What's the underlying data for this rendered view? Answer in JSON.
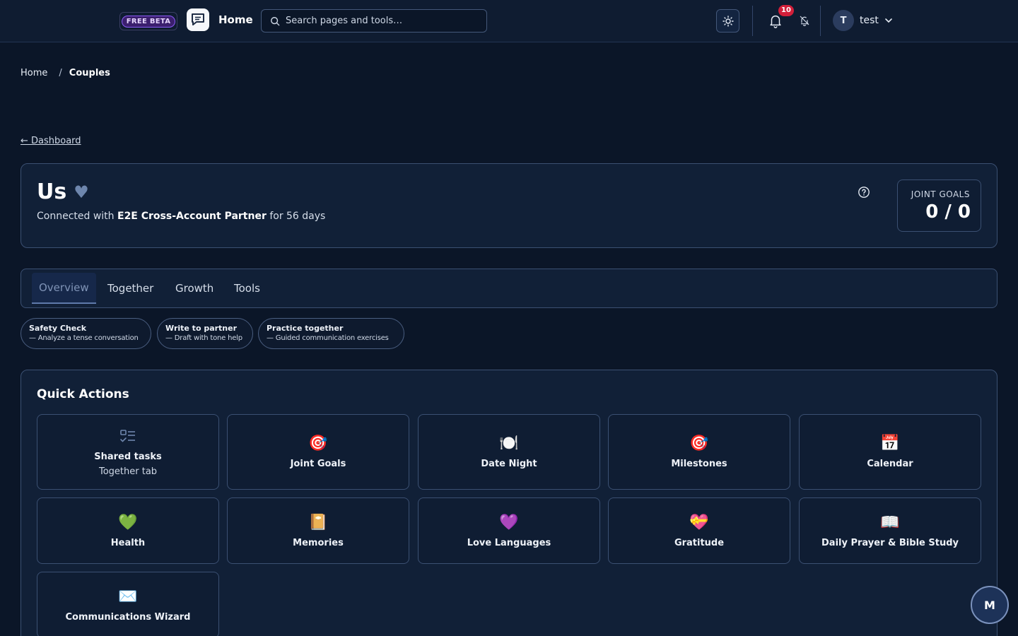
{
  "topbar": {
    "beta_label": "FREE BETA",
    "brand": "Home",
    "search_placeholder": "Search pages and tools…",
    "notification_count": "10",
    "user_initial": "T",
    "user_name": "test"
  },
  "breadcrumb": {
    "home": "Home",
    "separator": "/",
    "current": "Couples"
  },
  "back_link": "← Dashboard",
  "hero": {
    "title": "Us",
    "heart": "♥",
    "subtitle_pre": "Connected with ",
    "partner": "E2E Cross-Account Partner",
    "subtitle_post": " for 56 days",
    "goals_label": "JOINT GOALS",
    "goals_value": "0 / 0"
  },
  "tabs": [
    {
      "label": "Overview"
    },
    {
      "label": "Together"
    },
    {
      "label": "Growth"
    },
    {
      "label": "Tools"
    }
  ],
  "chips": [
    {
      "title": "Safety Check",
      "desc": "— Analyze a tense conversation"
    },
    {
      "title": "Write to partner",
      "desc": "— Draft with tone help"
    },
    {
      "title": "Practice together",
      "desc": "— Guided communication exercises"
    }
  ],
  "quick_actions": {
    "title": "Quick Actions",
    "cards": [
      {
        "icon": "📋",
        "label": "Shared tasks",
        "sub": "Together tab"
      },
      {
        "icon": "🎯",
        "label": "Joint Goals"
      },
      {
        "icon": "🍽️",
        "label": "Date Night"
      },
      {
        "icon": "🎯",
        "label": "Milestones"
      },
      {
        "icon": "📅",
        "label": "Calendar"
      },
      {
        "icon": "💚",
        "label": "Health"
      },
      {
        "icon": "📔",
        "label": "Memories"
      },
      {
        "icon": "💜",
        "label": "Love Languages"
      },
      {
        "icon": "💝",
        "label": "Gratitude"
      },
      {
        "icon": "📖",
        "label": "Daily Prayer & Bible Study"
      },
      {
        "icon": "✉️",
        "label": "Communications Wizard"
      }
    ]
  },
  "fab_label": "M"
}
